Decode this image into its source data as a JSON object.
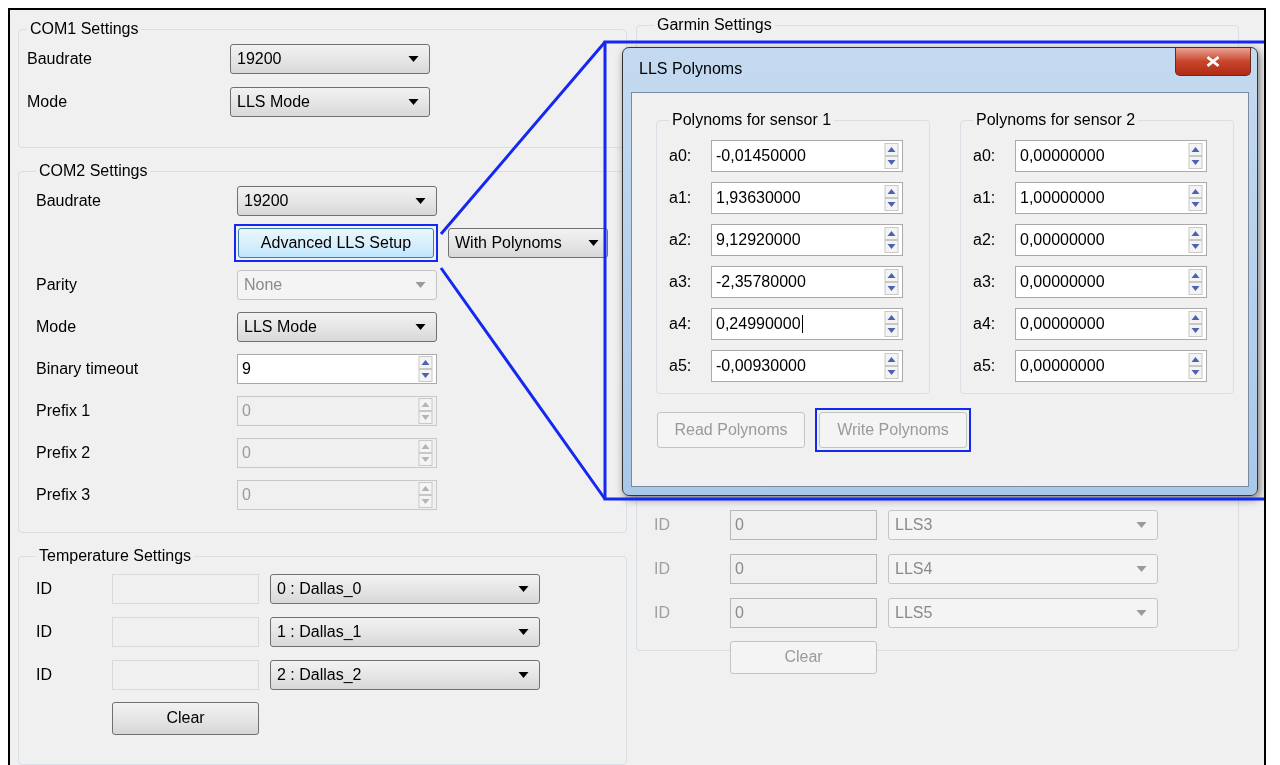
{
  "com1": {
    "title": "COM1 Settings",
    "fields": [
      {
        "kind": "dropdown",
        "label": "Baudrate",
        "value": "19200",
        "disabled": false
      },
      {
        "kind": "dropdown",
        "label": "Mode",
        "value": "LLS Mode",
        "disabled": false
      }
    ]
  },
  "com2": {
    "title": "COM2 Settings",
    "fields": [
      {
        "kind": "dropdown",
        "label": "Baudrate",
        "value": "19200",
        "disabled": false
      },
      {
        "kind": "setup",
        "button": "Advanced LLS Setup",
        "highlighted": true,
        "value": "With Polynoms",
        "disabled": false
      },
      {
        "kind": "dropdown",
        "label": "Parity",
        "value": "None",
        "disabled": true
      },
      {
        "kind": "dropdown",
        "label": "Mode",
        "value": "LLS Mode",
        "disabled": false
      },
      {
        "kind": "spin",
        "label": "Binary timeout",
        "value": "9",
        "disabled": false
      },
      {
        "kind": "spin",
        "label": "Prefix 1",
        "value": "0",
        "disabled": true
      },
      {
        "kind": "spin",
        "label": "Prefix 2",
        "value": "0",
        "disabled": true
      },
      {
        "kind": "spin",
        "label": "Prefix 3",
        "value": "0",
        "disabled": true
      }
    ]
  },
  "temperature": {
    "title": "Temperature Settings",
    "rows": [
      {
        "label": "ID",
        "sensor": "0 : Dallas_0",
        "disabled": false
      },
      {
        "label": "ID",
        "sensor": "1 : Dallas_1",
        "disabled": false
      },
      {
        "label": "ID",
        "sensor": "2 : Dallas_2",
        "disabled": false
      }
    ],
    "clear_button": {
      "label": "Clear",
      "disabled": false
    }
  },
  "garmin": {
    "title": "Garmin Settings",
    "rows": [
      {
        "label": "ID",
        "id": "0",
        "sensor": "LLS3",
        "disabled": true
      },
      {
        "label": "ID",
        "id": "0",
        "sensor": "LLS4",
        "disabled": true
      },
      {
        "label": "ID",
        "id": "0",
        "sensor": "LLS5",
        "disabled": true
      }
    ],
    "clear_button": {
      "label": "Clear",
      "disabled": true
    }
  },
  "dialog": {
    "title": "LLS Polynoms",
    "groups": [
      {
        "title": "Polynoms for sensor 1",
        "coefficients": [
          {
            "label": "a0:",
            "value": "-0,01450000",
            "focused": false
          },
          {
            "label": "a1:",
            "value": "1,93630000",
            "focused": false
          },
          {
            "label": "a2:",
            "value": "9,12920000",
            "focused": false
          },
          {
            "label": "a3:",
            "value": "-2,35780000",
            "focused": false
          },
          {
            "label": "a4:",
            "value": "0,24990000",
            "focused": true
          },
          {
            "label": "a5:",
            "value": "-0,00930000",
            "focused": false
          }
        ]
      },
      {
        "title": "Polynoms for sensor 2",
        "coefficients": [
          {
            "label": "a0:",
            "value": "0,00000000",
            "focused": false
          },
          {
            "label": "a1:",
            "value": "1,00000000",
            "focused": false
          },
          {
            "label": "a2:",
            "value": "0,00000000",
            "focused": false
          },
          {
            "label": "a3:",
            "value": "0,00000000",
            "focused": false
          },
          {
            "label": "a4:",
            "value": "0,00000000",
            "focused": false
          },
          {
            "label": "a5:",
            "value": "0,00000000",
            "focused": false
          }
        ]
      }
    ],
    "buttons": [
      {
        "label": "Read Polynoms",
        "disabled": true,
        "highlighted": false
      },
      {
        "label": "Write Polynoms",
        "disabled": true,
        "highlighted": true
      }
    ]
  }
}
